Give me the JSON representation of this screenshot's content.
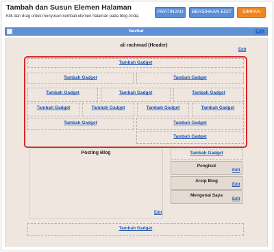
{
  "header": {
    "title": "Tambah dan Susun Elemen Halaman",
    "description": "Klik dan drag untuk menyusun kembali elemen halaman pada blog Anda."
  },
  "toolbar": {
    "preview": "PRATINJAU",
    "clear": "BERSIHKAN EDIT",
    "save": "SIMPAN"
  },
  "navbar": {
    "label": "Navbar",
    "edit": "Edit"
  },
  "layout": {
    "header_label": "ali rachmad (Header)",
    "header_edit": "Edit",
    "add_gadget": "Tambah Gadget",
    "posting_label": "Posting Blog",
    "posting_edit": "Edit",
    "sidebar": [
      {
        "title": "Pengikut",
        "edit": "Edit"
      },
      {
        "title": "Arsip Blog",
        "edit": "Edit"
      },
      {
        "title": "Mengenai Saya",
        "edit": "Edit"
      }
    ]
  },
  "colors": {
    "accent": "#5f8fd4",
    "save": "#f2841e",
    "highlight": "#d8262a",
    "link": "#1d55b6"
  }
}
